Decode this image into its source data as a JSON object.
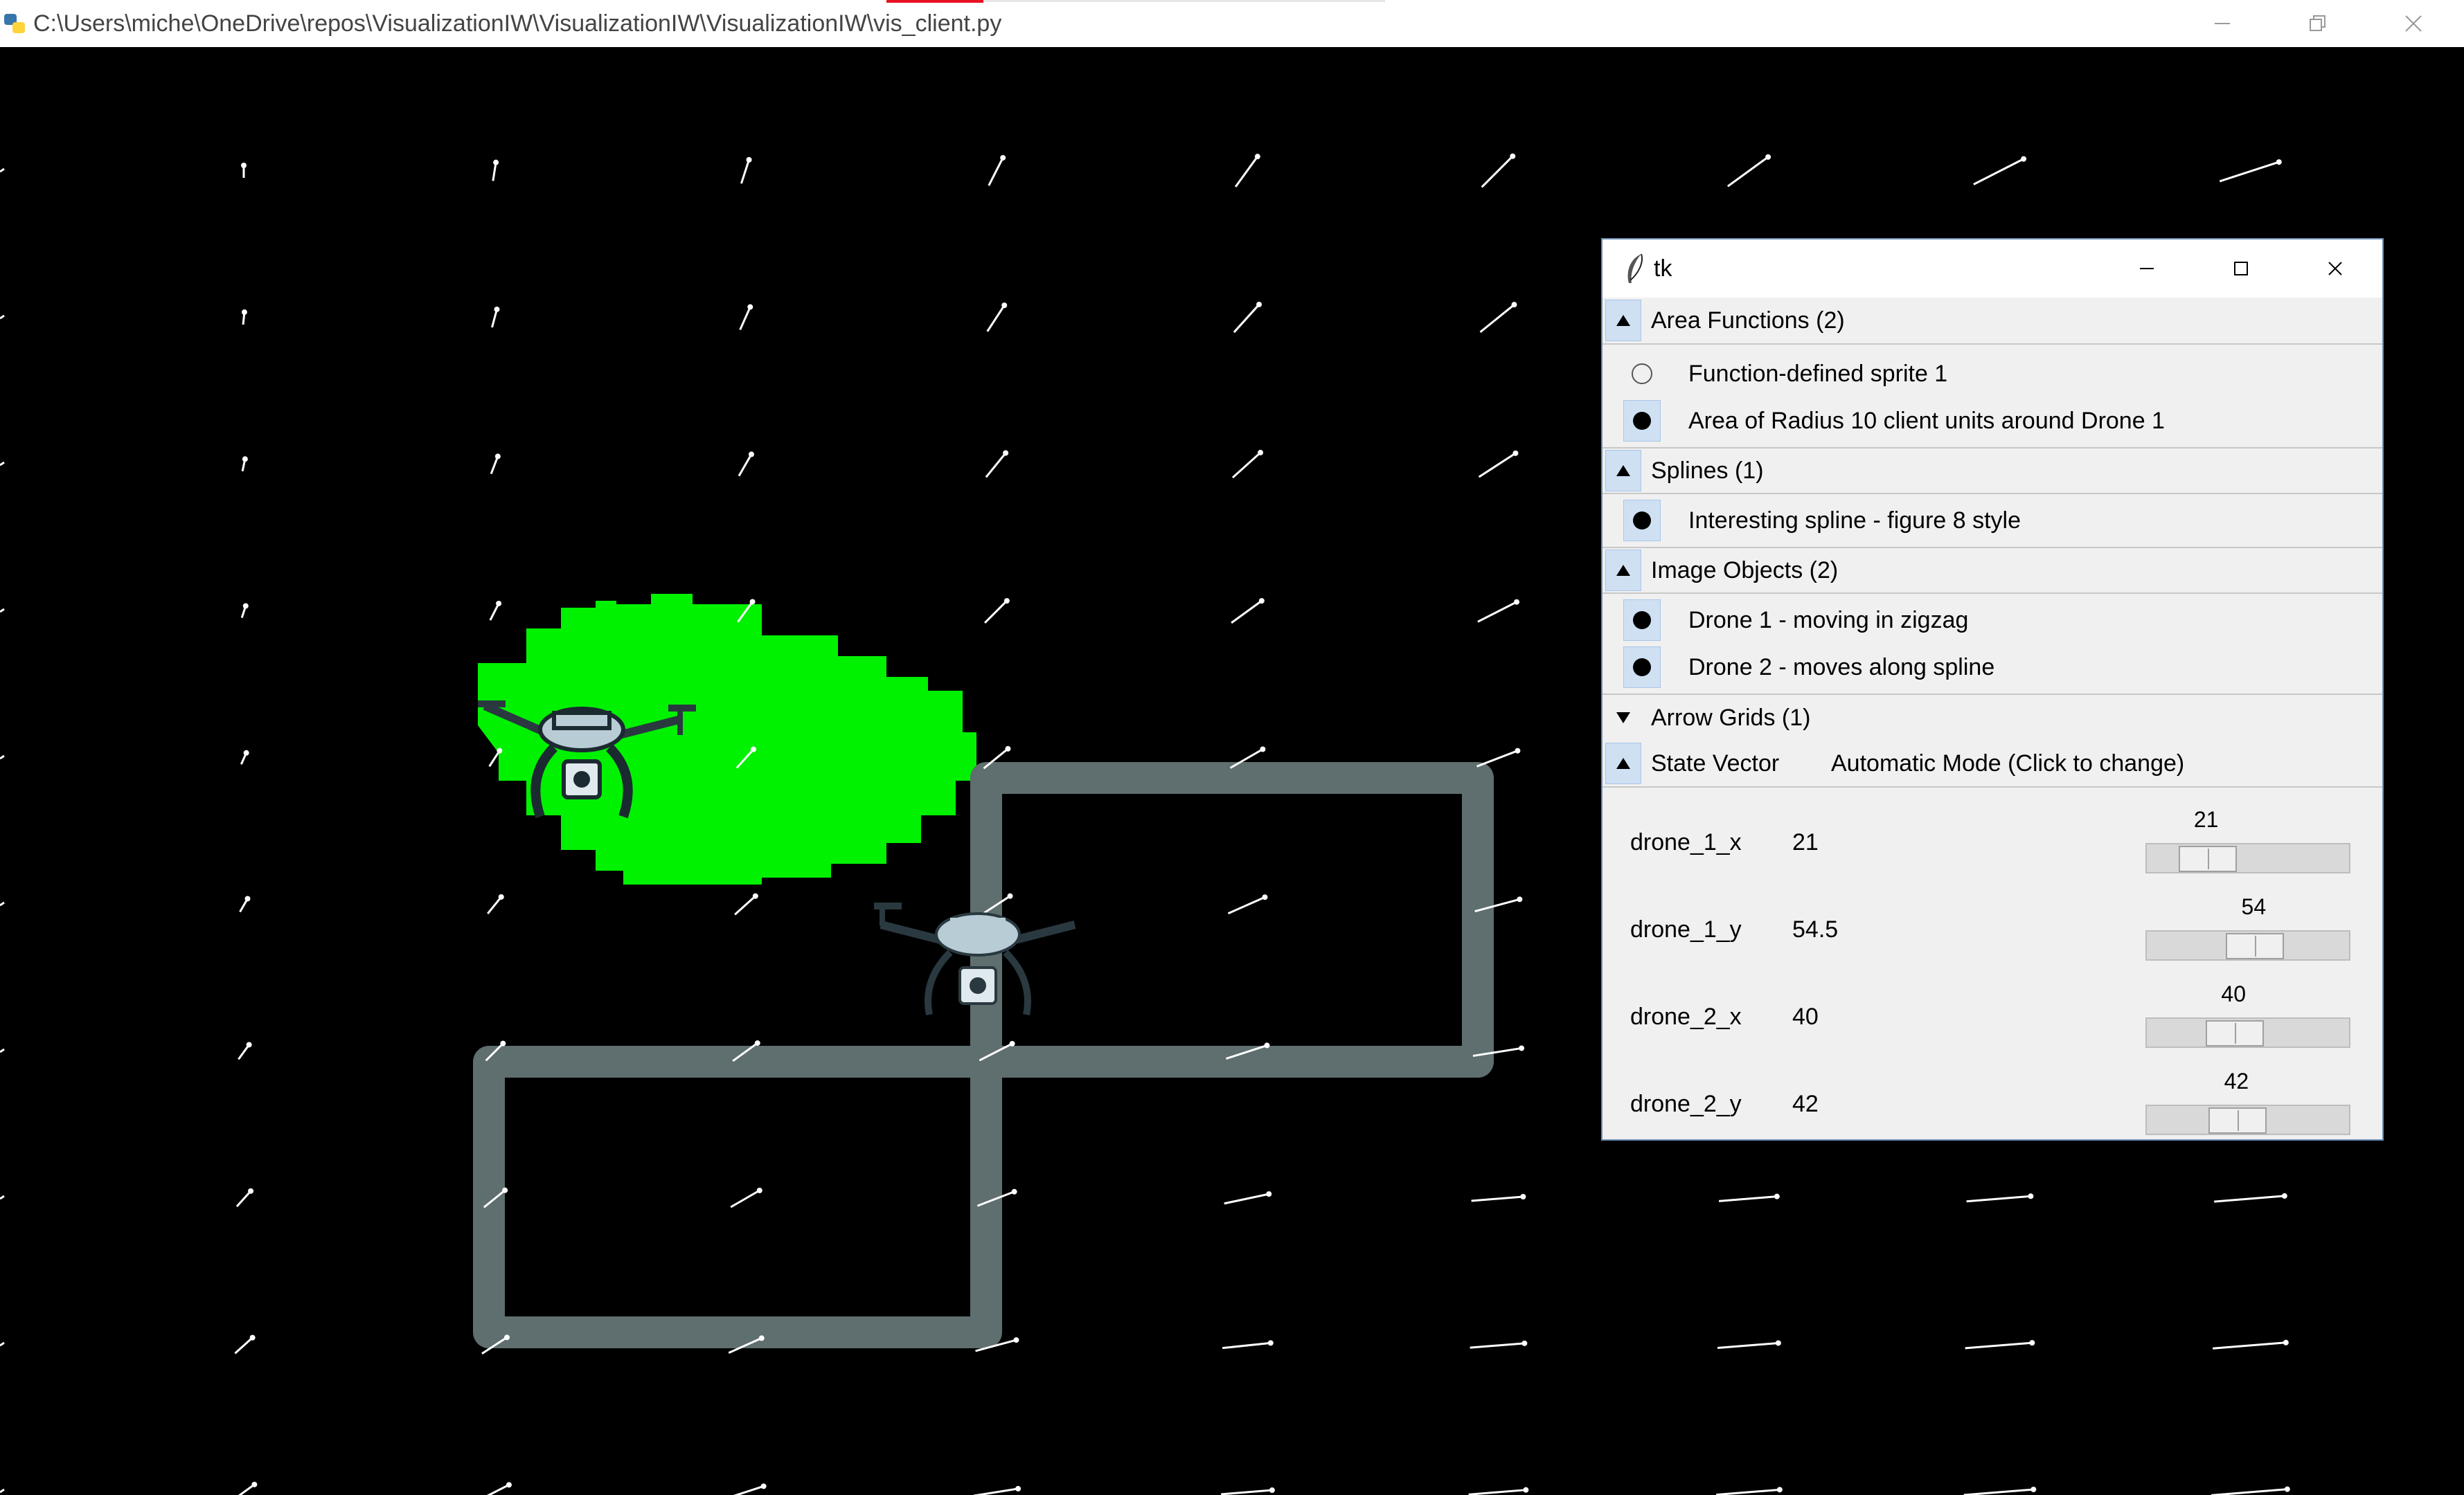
{
  "window": {
    "title": "C:\\Users\\miche\\OneDrive\\repos\\VisualizationIW\\VisualizationIW\\VisualizationIW\\vis_client.py",
    "minimize": "–",
    "restore": "❐",
    "close": "✕"
  },
  "canvas": {
    "background": "#000000",
    "area_color": "#00ff00",
    "spline_color": "#5f6e6e",
    "arrow_color": "#ffffff",
    "sprites": [
      "drone-icon",
      "drone-icon"
    ]
  },
  "tk_panel": {
    "title": "tk",
    "sections": [
      {
        "label": "Area Functions (2)",
        "expanded": true,
        "items": [
          {
            "label": "Function-defined sprite 1",
            "selected": false
          },
          {
            "label": "Area of Radius 10 client units around Drone 1",
            "selected": true
          }
        ]
      },
      {
        "label": "Splines (1)",
        "expanded": true,
        "items": [
          {
            "label": "Interesting spline - figure 8 style",
            "selected": true
          }
        ]
      },
      {
        "label": "Image Objects (2)",
        "expanded": true,
        "items": [
          {
            "label": "Drone 1 - moving in zigzag",
            "selected": true
          },
          {
            "label": "Drone 2 - moves along spline",
            "selected": true
          }
        ]
      },
      {
        "label": "Arrow Grids (1)",
        "expanded": false,
        "items": []
      }
    ],
    "state_vector": {
      "label": "State Vector",
      "mode": "Automatic Mode (Click to change)",
      "vars": [
        {
          "name": "drone_1_x",
          "value": "21",
          "slider": "21",
          "fraction": 0.21
        },
        {
          "name": "drone_1_y",
          "value": "54.5",
          "slider": "54",
          "fraction": 0.54
        },
        {
          "name": "drone_2_x",
          "value": "40",
          "slider": "40",
          "fraction": 0.4
        },
        {
          "name": "drone_2_y",
          "value": "42",
          "slider": "42",
          "fraction": 0.42
        }
      ]
    }
  }
}
